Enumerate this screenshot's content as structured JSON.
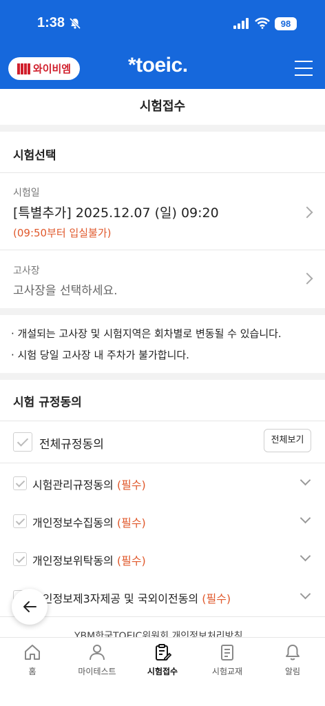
{
  "status_bar": {
    "time": "1:38",
    "battery": "98"
  },
  "header": {
    "brand_text": "와이비엠",
    "logo_text": "*toeic."
  },
  "page": {
    "title": "시험접수"
  },
  "exam_select": {
    "heading": "시험선택",
    "date_label": "시험일",
    "date_value": "[특별추가] 2025.12.07 (일) 09:20",
    "date_note": "(09:50부터 입실불가)",
    "venue_label": "고사장",
    "venue_placeholder": "고사장을 선택하세요."
  },
  "notices": [
    "· 개설되는 고사장 및 시험지역은 회차별로 변동될 수 있습니다.",
    "· 시험 당일 고사장 내 주차가 불가합니다."
  ],
  "terms": {
    "heading": "시험 규정동의",
    "agree_all": "전체규정동의",
    "view_all": "전체보기",
    "required_tag": "(필수)",
    "items": [
      {
        "label": "시험관리규정동의"
      },
      {
        "label": "개인정보수집동의"
      },
      {
        "label": "개인정보위탁동의"
      },
      {
        "label": "개인정보제3자제공 및 국외이전동의"
      }
    ],
    "cut_off_text": "YBM한국TOEIC위원회 개인정보처리방침"
  },
  "tabbar": {
    "items": [
      {
        "label": "홈",
        "icon": "home-icon"
      },
      {
        "label": "마이테스트",
        "icon": "user-icon"
      },
      {
        "label": "시험접수",
        "icon": "clipboard-edit-icon",
        "active": true
      },
      {
        "label": "시험교재",
        "icon": "book-icon"
      },
      {
        "label": "알림",
        "icon": "bell-icon"
      }
    ]
  }
}
